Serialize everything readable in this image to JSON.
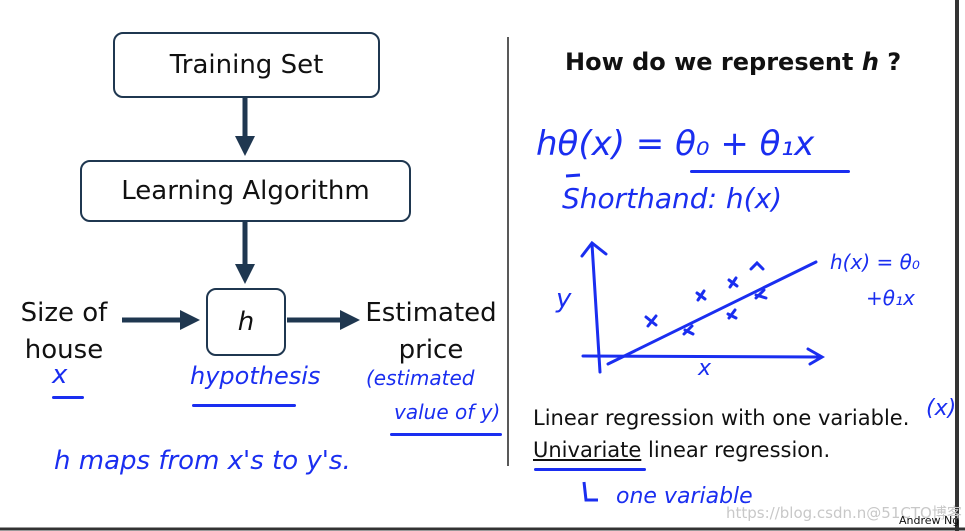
{
  "diagram": {
    "training_set": "Training Set",
    "learning_algorithm": "Learning Algorithm",
    "hypothesis_symbol": "h",
    "input_label_line1": "Size of",
    "input_label_line2": "house",
    "output_label_line1": "Estimated",
    "output_label_line2": "price"
  },
  "right": {
    "title_prefix": "How do we represent ",
    "title_var": "h",
    "title_suffix": " ?",
    "line1": "Linear regression with one variable.",
    "line2_underlined": "Univariate",
    "line2_rest": " linear regression."
  },
  "annotations": {
    "x_under_input": "x",
    "hypothesis": "hypothesis",
    "estimated_value": "(estimated",
    "estimated_value2": "value of y)",
    "maps": "h   maps  from  x's  to y's.",
    "formula": "hθ(x)  =  θ₀ + θ₁x",
    "shorthand": "Shorthand:  h(x)",
    "plot_y": "y",
    "plot_x": "x",
    "plot_line_label1": "h(x) = θ₀",
    "plot_line_label2": "+θ₁x",
    "x_paren": "(x)",
    "one_variable": "one  variable"
  },
  "footer": {
    "author": "Andrew Ng",
    "watermark": "https://blog.csdn.n@51CTO博客"
  },
  "colors": {
    "ink": "#1a2ef0",
    "box_border": "#1f3750"
  }
}
